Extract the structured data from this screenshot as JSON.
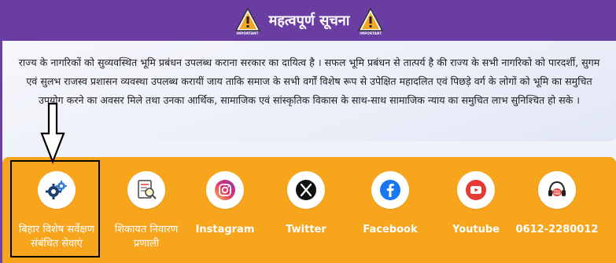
{
  "header": {
    "title": "महत्वपूर्ण सूचना",
    "badge_text": "IMPORTANT"
  },
  "notice": {
    "text": "राज्य के नागरिकों को सुव्यवस्थित भूमि प्रबंधन उपलब्ध कराना सरकार का दायित्व है । सफल भूमि प्रबंधन से तात्पर्य है की राज्य के सभी नागरिको को पारदर्शी, सुगम एवं  सुलभ राजस्व प्रशासन व्यवस्था उपलब्ध करायीं जाय ताकि समाज के सभी वर्गों विशेष रूप से उपेक्षित महादलित एवं पिछड़े वर्ग के लोगों को भूमि का समुचित उपयोग करने का अवसर मिले तथा उनका आर्थिक, सामाजिक एवं सांस्कृतिक विकास के साथ-साथ सामाजिक न्याय का समुचित लाभ सुनिश्चित हो सके ।"
  },
  "services": [
    {
      "label": "बिहार विशेष सर्वेक्षण संबंधित सेवाएं",
      "icon": "gears-icon"
    },
    {
      "label": "शिकायत निवारण प्रणाली",
      "icon": "grievance-document-icon"
    },
    {
      "label": "Instagram",
      "icon": "instagram-icon"
    },
    {
      "label": "Twitter",
      "icon": "x-twitter-icon"
    },
    {
      "label": "Facebook",
      "icon": "facebook-icon"
    },
    {
      "label": "Youtube",
      "icon": "youtube-icon"
    },
    {
      "label": "0612-2280012",
      "icon": "toll-free-icon"
    }
  ],
  "colors": {
    "header_bg": "#6a3da3",
    "strip_bg": "#f7a51d",
    "text": "#222222"
  }
}
